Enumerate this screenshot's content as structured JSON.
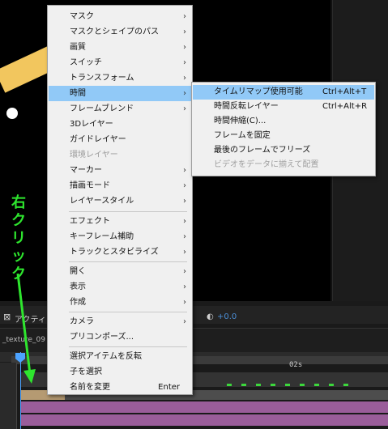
{
  "menu": {
    "items": [
      {
        "label": "マスク",
        "submenu": true
      },
      {
        "label": "マスクとシェイプのパス",
        "submenu": true
      },
      {
        "label": "画質",
        "submenu": true
      },
      {
        "label": "スイッチ",
        "submenu": true
      },
      {
        "label": "トランスフォーム",
        "submenu": true
      },
      {
        "label": "時間",
        "submenu": true,
        "highlighted": true
      },
      {
        "label": "フレームブレンド",
        "submenu": true
      },
      {
        "label": "3Dレイヤー"
      },
      {
        "label": "ガイドレイヤー"
      },
      {
        "label": "環境レイヤー",
        "disabled": true
      },
      {
        "label": "マーカー",
        "submenu": true
      },
      {
        "label": "描画モード",
        "submenu": true
      },
      {
        "label": "レイヤースタイル",
        "submenu": true
      },
      {
        "label": "エフェクト",
        "submenu": true
      },
      {
        "label": "キーフレーム補助",
        "submenu": true
      },
      {
        "label": "トラックとスタビライズ",
        "submenu": true
      },
      {
        "label": "開く",
        "submenu": true
      },
      {
        "label": "表示",
        "submenu": true
      },
      {
        "label": "作成",
        "submenu": true
      },
      {
        "label": "カメラ",
        "submenu": true
      },
      {
        "label": "プリコンポーズ..."
      },
      {
        "label": "選択アイテムを反転"
      },
      {
        "label": "子を選択"
      },
      {
        "label": "名前を変更",
        "shortcut": "Enter"
      }
    ],
    "arrow_glyph": "›"
  },
  "submenu": {
    "items": [
      {
        "label": "タイムリマップ使用可能",
        "shortcut": "Ctrl+Alt+T",
        "highlighted": true
      },
      {
        "label": "時間反転レイヤー",
        "shortcut": "Ctrl+Alt+R"
      },
      {
        "label": "時間伸縮(C)..."
      },
      {
        "label": "フレームを固定"
      },
      {
        "label": "最後のフレームでフリーズ"
      },
      {
        "label": "ビデオをデータに揃えて配置",
        "disabled": true
      }
    ]
  },
  "annotation": {
    "text": "右クリック",
    "color": "#2ee62e"
  },
  "timeline": {
    "layer_name": "_texture_09",
    "ruler_label": "02s",
    "offset_value": "+0.0",
    "toolbar_fragment": "アクティ"
  },
  "colors": {
    "highlight": "#91c9f7",
    "layer_bar": "#9a5d9a",
    "object": "#f2c65e",
    "accent_blue": "#4ca3ff"
  }
}
